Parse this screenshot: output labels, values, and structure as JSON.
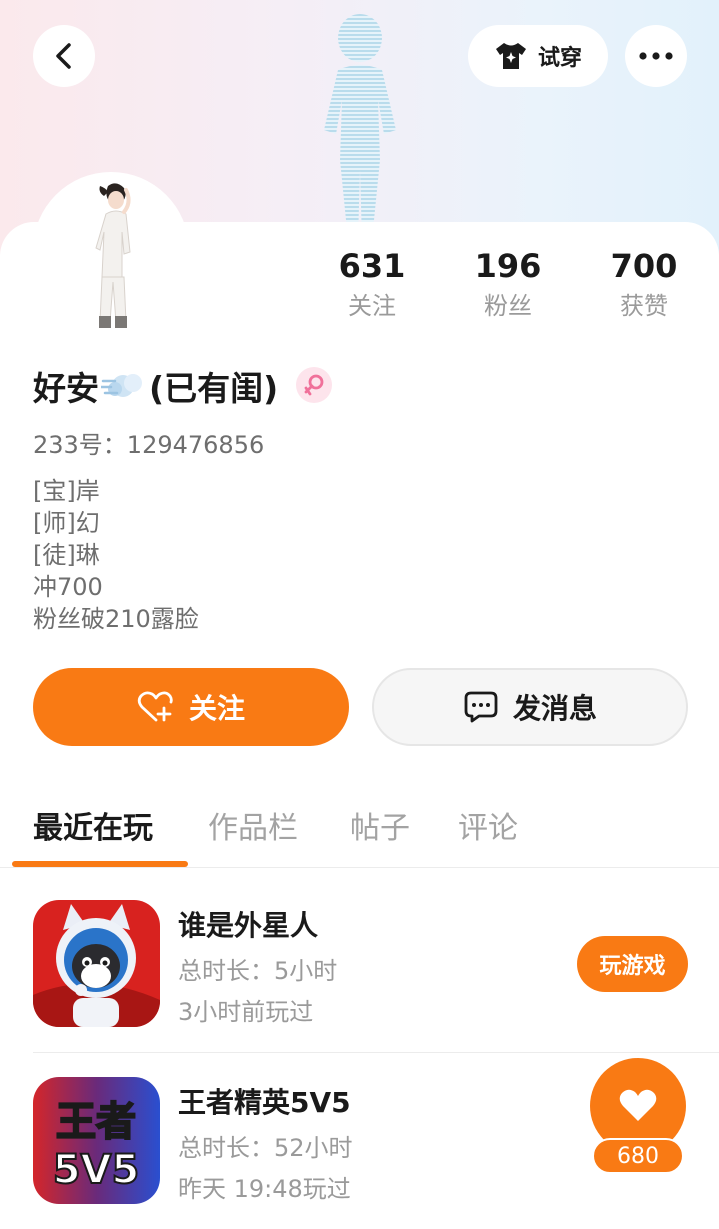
{
  "header": {
    "try_on_label": "试穿",
    "icons": {
      "back": "chevron-left-icon",
      "try_on": "shirt-sparkle-icon",
      "more": "more-dots-icon"
    }
  },
  "stats": [
    {
      "value": "631",
      "label": "关注"
    },
    {
      "value": "196",
      "label": "粉丝"
    },
    {
      "value": "700",
      "label": "获赞"
    }
  ],
  "profile": {
    "name_prefix": "好安",
    "name_suffix": "(已有闺)",
    "emoji_icon": "wind-puff-icon",
    "gender_icon": "female-icon",
    "uid": "233号：129476856",
    "bio_lines": [
      "[宝]岸",
      "[师]幻",
      "[徒]琳",
      "冲700",
      "粉丝破210露脸"
    ]
  },
  "actions": {
    "follow_label": "关注",
    "message_label": "发消息"
  },
  "tabs": [
    "最近在玩",
    "作品栏",
    "帖子",
    "评论"
  ],
  "active_tab": "最近在玩",
  "games": [
    {
      "title": "谁是外星人",
      "duration": "总时长：5小时",
      "last_played": "3小时前玩过",
      "button": "玩游戏",
      "icon": "astronaut-cat-icon"
    },
    {
      "title": "王者精英5V5",
      "duration": "总时长：52小时",
      "last_played": "昨天 19:48玩过",
      "icon_text_top": "王者",
      "icon_text_bottom": "5V5",
      "icon": "game-logo-icon"
    }
  ],
  "like_fab": {
    "count": "680",
    "icon": "heart-icon"
  },
  "colors": {
    "accent": "#f97a14",
    "muted": "#9a9a9a",
    "text": "#1a1a1a"
  }
}
